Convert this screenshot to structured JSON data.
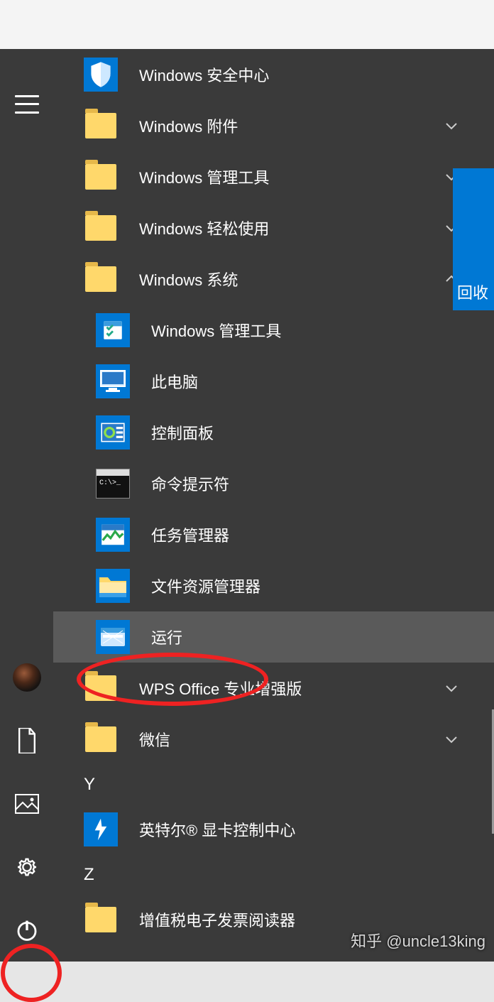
{
  "leftRail": {
    "icons": [
      "hamburger",
      "avatar",
      "documents",
      "pictures",
      "settings",
      "power"
    ]
  },
  "recycleTile": {
    "label": "回收"
  },
  "watermark": "知乎 @uncle13king",
  "sections": [
    {
      "type": "app",
      "icon": "shield",
      "label": "Windows 安全中心"
    },
    {
      "type": "folder",
      "label": "Windows 附件",
      "chev": "down"
    },
    {
      "type": "folder",
      "label": "Windows 管理工具",
      "chev": "down"
    },
    {
      "type": "folder",
      "label": "Windows 轻松使用",
      "chev": "down"
    },
    {
      "type": "folder",
      "label": "Windows 系统",
      "chev": "up",
      "expanded": true,
      "children": [
        {
          "icon": "admin-tools",
          "label": "Windows 管理工具"
        },
        {
          "icon": "this-pc",
          "label": "此电脑"
        },
        {
          "icon": "control-panel",
          "label": "控制面板"
        },
        {
          "icon": "cmd",
          "label": "命令提示符"
        },
        {
          "icon": "task-manager",
          "label": "任务管理器"
        },
        {
          "icon": "file-explorer",
          "label": "文件资源管理器"
        },
        {
          "icon": "run",
          "label": "运行",
          "hovered": true
        }
      ]
    },
    {
      "type": "folder",
      "label": "WPS Office 专业增强版",
      "chev": "down"
    },
    {
      "type": "folder",
      "label": "微信",
      "chev": "down"
    },
    {
      "type": "letter",
      "label": "Y"
    },
    {
      "type": "app",
      "icon": "intel",
      "label": "英特尔® 显卡控制中心"
    },
    {
      "type": "letter",
      "label": "Z"
    },
    {
      "type": "app",
      "icon": "folder",
      "label": "增值税电子发票阅读器"
    }
  ]
}
